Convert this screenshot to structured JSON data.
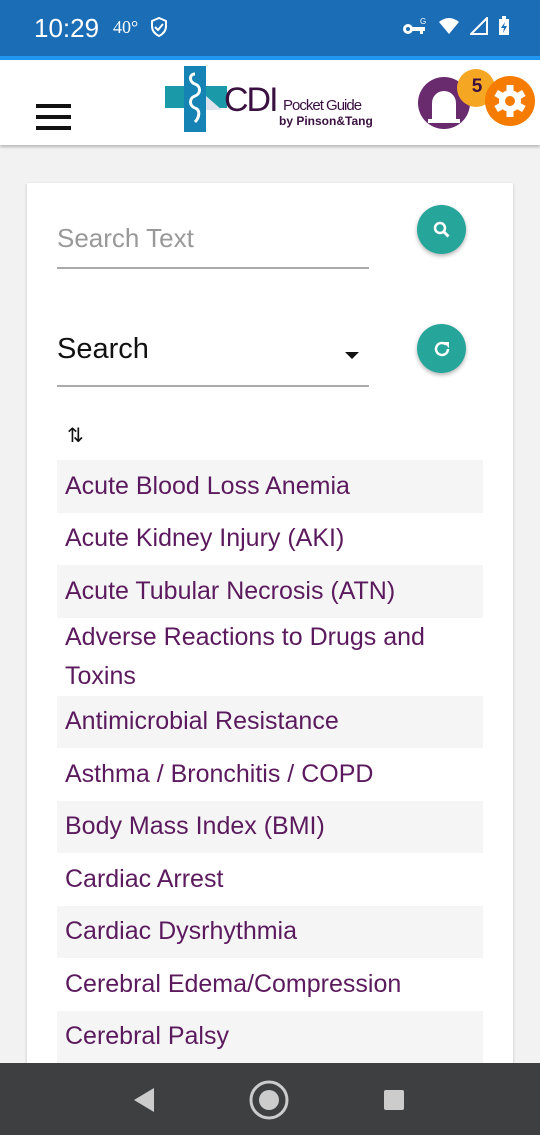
{
  "status_bar": {
    "time": "10:29",
    "temperature": "40°",
    "icons": [
      "shield-check-icon",
      "vpn-key-icon",
      "wifi-icon",
      "signal-icon",
      "battery-charging-icon"
    ]
  },
  "header": {
    "logo": {
      "title": "CDI",
      "subtitle": "Pocket Guide",
      "byline": "by Pinson&Tang"
    },
    "notification_count": "5",
    "brand_colors": {
      "purple": "#6a2a6e",
      "orange": "#f57c00",
      "badge": "#f5a623"
    }
  },
  "search": {
    "placeholder": "Search Text",
    "value": "",
    "dropdown_value": "Search",
    "accent": "#26a69a"
  },
  "list": {
    "items": [
      "Acute Blood Loss Anemia",
      "Acute Kidney Injury (AKI)",
      "Acute Tubular Necrosis (ATN)",
      "Adverse Reactions to Drugs and Toxins",
      "Antimicrobial Resistance",
      "Asthma / Bronchitis / COPD",
      "Body Mass Index (BMI)",
      "Cardiac Arrest",
      "Cardiac Dysrhythmia",
      "Cerebral Edema/Compression",
      "Cerebral Palsy"
    ],
    "text_color": "#5c1a5e"
  }
}
